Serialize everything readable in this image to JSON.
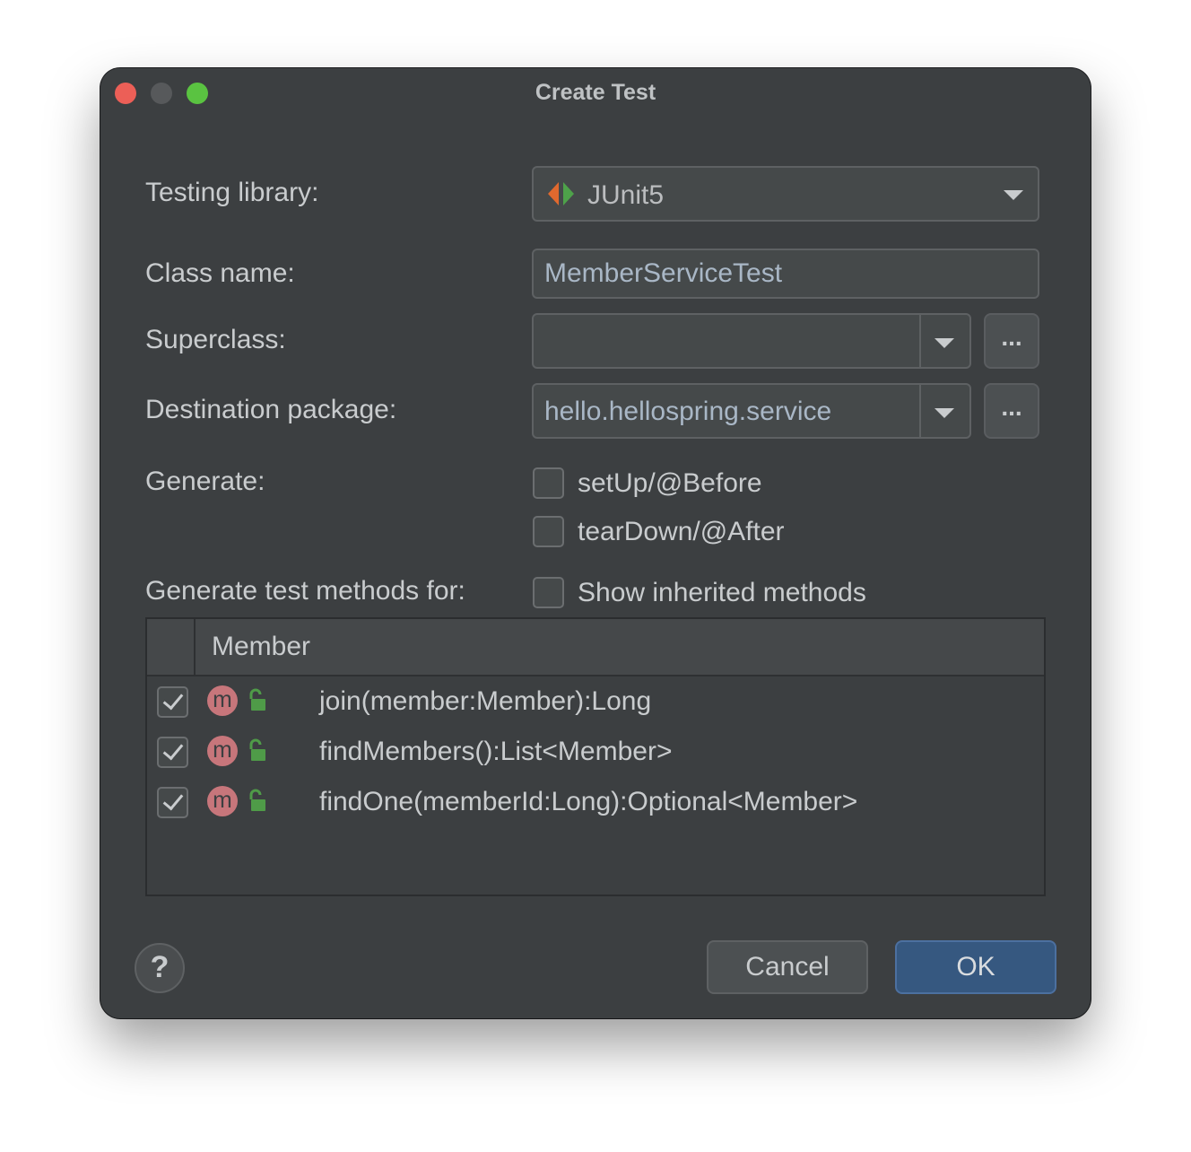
{
  "window": {
    "title": "Create Test"
  },
  "form": {
    "testing_library_label": "Testing library:",
    "testing_library_value": "JUnit5",
    "class_name_label": "Class name:",
    "class_name_value": "MemberServiceTest",
    "superclass_label": "Superclass:",
    "superclass_value": "",
    "destination_package_label": "Destination package:",
    "destination_package_value": "hello.hellospring.service",
    "browse_label": "...",
    "generate_label": "Generate:",
    "setup_label": "setUp/@Before",
    "setup_checked": false,
    "teardown_label": "tearDown/@After",
    "teardown_checked": false,
    "generate_methods_label": "Generate test methods for:",
    "show_inherited_label": "Show inherited methods",
    "show_inherited_checked": false
  },
  "table": {
    "column_header": "Member",
    "rows": [
      {
        "checked": true,
        "icon": "m",
        "text": "join(member:Member):Long"
      },
      {
        "checked": true,
        "icon": "m",
        "text": "findMembers():List<Member>"
      },
      {
        "checked": true,
        "icon": "m",
        "text": "findOne(memberId:Long):Optional<Member>"
      }
    ]
  },
  "footer": {
    "help_label": "?",
    "cancel_label": "Cancel",
    "ok_label": "OK"
  },
  "colors": {
    "background": "#3c3f41",
    "accent_button": "#365880",
    "method_icon": "#c7767b",
    "lock_icon": "#4f9b48"
  }
}
